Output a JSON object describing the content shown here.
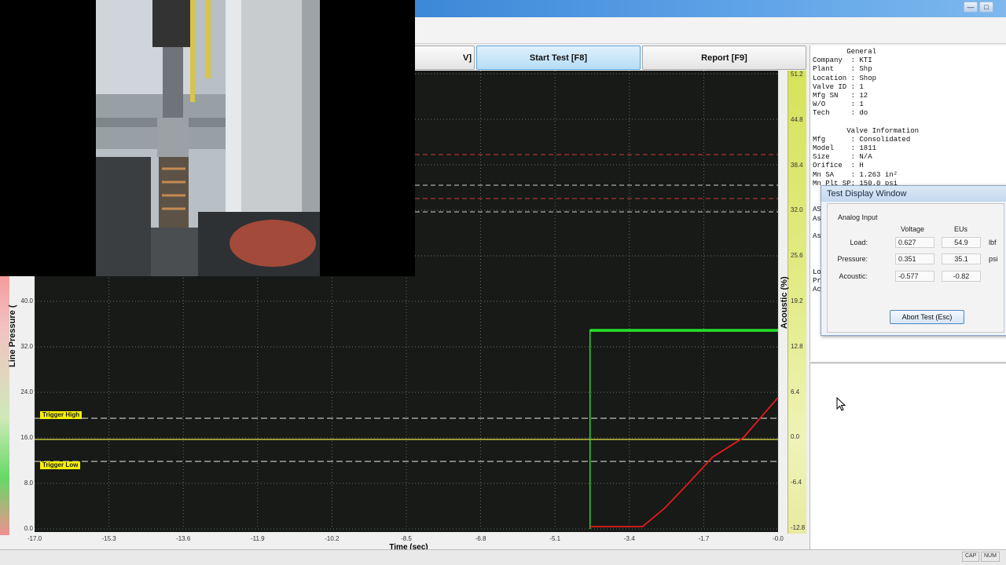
{
  "toolbar": {
    "partial_label": "V]",
    "start_test_label": "Start Test [F8]",
    "report_label": "Report [F9]"
  },
  "titlebar": {
    "minimize_glyph": "—",
    "maximize_glyph": "□"
  },
  "chart_data": {
    "type": "line",
    "xlabel": "Time (sec)",
    "ylabel": "Line Pressure (",
    "y2label": "Acoustic (%)",
    "x_ticks": [
      "-17.0",
      "-15.3",
      "-13.6",
      "-11.9",
      "-10.2",
      "-8.5",
      "-6.8",
      "-5.1",
      "-3.4",
      "-1.7",
      "-0.0"
    ],
    "xlim": [
      -17.0,
      0.0
    ],
    "y_ticks": [
      "40.0",
      "32.0",
      "24.0",
      "16.0",
      "8.0",
      "0.0"
    ],
    "y2_ticks": [
      "51.2",
      "44.8",
      "38.4",
      "32.0",
      "25.6",
      "19.2",
      "12.8",
      "6.4",
      "0.0",
      "-6.4",
      "-12.8"
    ],
    "y2lim": [
      -12.8,
      51.2
    ],
    "grid": true,
    "annotations": {
      "trigger_high": "Trigger High",
      "trigger_low": "Trigger Low"
    },
    "series": [
      {
        "color": "#27e62a",
        "x": [
          -4.3,
          -4.3,
          0.0
        ],
        "y": [
          0.0,
          34.9,
          34.9
        ]
      },
      {
        "color": "#e31b1b",
        "x": [
          -4.3,
          -3.1,
          -2.6,
          -2.1,
          -1.5,
          -0.8,
          0.0
        ],
        "y": [
          0.4,
          0.4,
          3.6,
          7.6,
          12.6,
          16.0,
          23.1
        ]
      }
    ]
  },
  "info_panel": {
    "lines": [
      "        General",
      "Company  : KTI",
      "Plant    : Shp",
      "Location : Shop",
      "Valve ID : 1",
      "Mfg SN   : 12",
      "W/O      : 1",
      "Tech     : do",
      "",
      "        Valve Information",
      "Mfg      : Consolidated",
      "Model    : 1811",
      "Size     : N/A",
      "Orifice  : H",
      "Mn SA    : 1.263 in²",
      "Mn Plt SP: 150.0 psi"
    ],
    "fragments": [
      "AS",
      "As",
      "As",
      "Lo",
      "Pr",
      "Ac"
    ]
  },
  "dialog": {
    "title": "Test Display Window",
    "group_label": "Analog Input",
    "col_voltage": "Voltage",
    "col_eus": "EUs",
    "rows": [
      {
        "label": "Load:",
        "voltage": "0.627",
        "eu": "54.9",
        "unit": "lbf"
      },
      {
        "label": "Pressure:",
        "voltage": "0.351",
        "eu": "35.1",
        "unit": "psi"
      },
      {
        "label": "Acoustic:",
        "voltage": "-0.577",
        "eu": "-0.82",
        "unit": ""
      }
    ],
    "abort_label": "Abort Test (Esc)"
  },
  "statusbar": {
    "cap": "CAP",
    "num": "NUM"
  }
}
